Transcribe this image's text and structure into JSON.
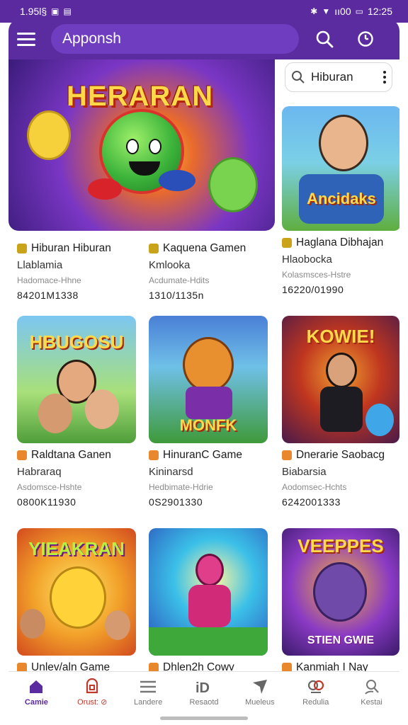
{
  "status": {
    "time_left": "1.95l§",
    "time_right": "12:25",
    "carrier": "ıı00"
  },
  "appbar": {
    "title": "Apponsh"
  },
  "hero": {
    "banner": "HERARAN"
  },
  "side_search": {
    "value": "Hiburan"
  },
  "cards": [
    {
      "title": "Hiburan Hiburan",
      "sub": "Llablamia",
      "tiny": "Hadomace-Hhne",
      "nums": "84201M1338",
      "banner": "",
      "accent": "#c9a31a"
    },
    {
      "title": "Kaquena Gamen",
      "sub": "Kmlooka",
      "tiny": "Acdumate-Hdits",
      "nums": "1310/1135n",
      "banner": "",
      "accent": "#c9a31a"
    },
    {
      "title": "Haglana Dibhajan",
      "sub": "Hlaobocka",
      "tiny": "Kolasmsces-Hstre",
      "nums": "16220/01990",
      "banner": "Ancidaks",
      "accent": "#c9a31a"
    },
    {
      "title": "Raldtana Ganen",
      "sub": "Habraraq",
      "tiny": "Asdomsce-Hshte",
      "nums": "0800K11930",
      "banner": "HBUGOSU",
      "accent": "#e8872c"
    },
    {
      "title": "HinuranC Game",
      "sub": "Kininarsd",
      "tiny": "Hedbimate-Hdrie",
      "nums": "0S2901330",
      "banner": "MONFK",
      "accent": "#e8872c"
    },
    {
      "title": "Dnerarie Saobacg",
      "sub": "Biabarsia",
      "tiny": "Aodomsec-Hchts",
      "nums": "6242001333",
      "banner": "KOWIE!",
      "accent": "#e8872c"
    },
    {
      "title": "Unlev/aln Game",
      "sub": "",
      "tiny": "",
      "nums": "",
      "banner": "YIEAKRAN",
      "accent": "#e8872c"
    },
    {
      "title": "Dhlen2h Cowv",
      "sub": "",
      "tiny": "",
      "nums": "",
      "banner": "",
      "accent": "#e8872c"
    },
    {
      "title": "Kanmiah I Nay",
      "sub": "",
      "tiny": "",
      "nums": "",
      "banner": "VEEPPES",
      "accent": "#e8872c"
    }
  ],
  "nav": [
    {
      "label": "Camie",
      "icon": "home-icon"
    },
    {
      "label": "Orust: ⊘",
      "icon": "collection-icon"
    },
    {
      "label": "Landere",
      "icon": "list-icon"
    },
    {
      "label": "Resaotd",
      "icon": "id-icon"
    },
    {
      "label": "Mueleus",
      "icon": "send-icon"
    },
    {
      "label": "Redulia",
      "icon": "gamepad-icon"
    },
    {
      "label": "Kestai",
      "icon": "profile-icon"
    }
  ]
}
